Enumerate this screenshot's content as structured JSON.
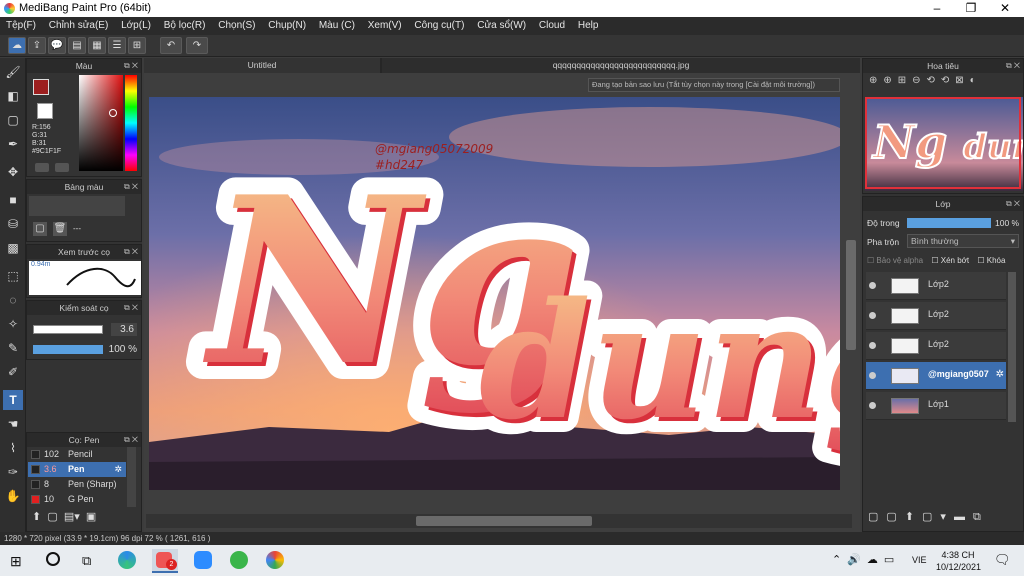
{
  "window": {
    "title": "MediBang Paint Pro (64bit)",
    "minimize": "–",
    "maximize": "❐",
    "close": "✕"
  },
  "menu": [
    "Tệp(F)",
    "Chỉnh sửa(E)",
    "Lớp(L)",
    "Bộ lọc(R)",
    "Chọn(S)",
    "Chụp(N)",
    "Màu (C)",
    "Xem(V)",
    "Công cụ(T)",
    "Cửa sổ(W)",
    "Cloud",
    "Help"
  ],
  "tabs": {
    "active": "Untitled",
    "other": "qqqqqqqqqqqqqqqqqqqqqqqqqq.jpg"
  },
  "canvas": {
    "notice": "Đang tạo bản sao lưu (Tắt tùy chọn này trong [Cài đặt môi trường])",
    "big_text_1": "Ng",
    "big_text_2": "dung",
    "watermark_1": "@mgiang05072009",
    "watermark_2": "#hd247"
  },
  "color_panel": {
    "title": "Màu",
    "r": "R:156",
    "g": "G:31",
    "b": "B:31",
    "hex": "#9C1F1F",
    "main_color": "#9c1f1f"
  },
  "palette_panel": {
    "title": "Bảng màu",
    "value": "---"
  },
  "preview_panel": {
    "title": "Xem trước cọ",
    "size": "0.94m"
  },
  "brush_control": {
    "title": "Kiểm soát cọ",
    "size": "3.6",
    "opacity": "100 %"
  },
  "brush_list": {
    "title": "Cọ: Pen",
    "items": [
      {
        "size": "102",
        "name": "Pencil",
        "color": "#222222"
      },
      {
        "size": "3.6",
        "name": "Pen",
        "color": "#222222"
      },
      {
        "size": "8",
        "name": "Pen (Sharp)",
        "color": "#222222"
      },
      {
        "size": "10",
        "name": "G Pen",
        "color": "#e02020"
      }
    ]
  },
  "navigator": {
    "title": "Hoa tiêu"
  },
  "layer_panel": {
    "title": "Lớp",
    "opacity_label": "Độ trong",
    "opacity_value": "100 %",
    "blend_label": "Pha trộn",
    "blend_value": "Bình thường",
    "protect_alpha": "Bảo vệ alpha",
    "clip": "Xén bớt",
    "lock": "Khóa",
    "layers": [
      {
        "name": "Lớp2",
        "selected": false
      },
      {
        "name": "Lớp2",
        "selected": false
      },
      {
        "name": "Lớp2",
        "selected": false
      },
      {
        "name": "@mgiang0507",
        "selected": true
      },
      {
        "name": "Lớp1",
        "selected": false
      }
    ]
  },
  "status": {
    "text": "1280 * 720 pixel   (33.9 * 19.1cm)   96 dpi   72 %   ( 1261, 616 )"
  },
  "taskbar": {
    "lang": "VIE",
    "time": "4:38 CH",
    "date": "10/12/2021",
    "badge": "2"
  }
}
